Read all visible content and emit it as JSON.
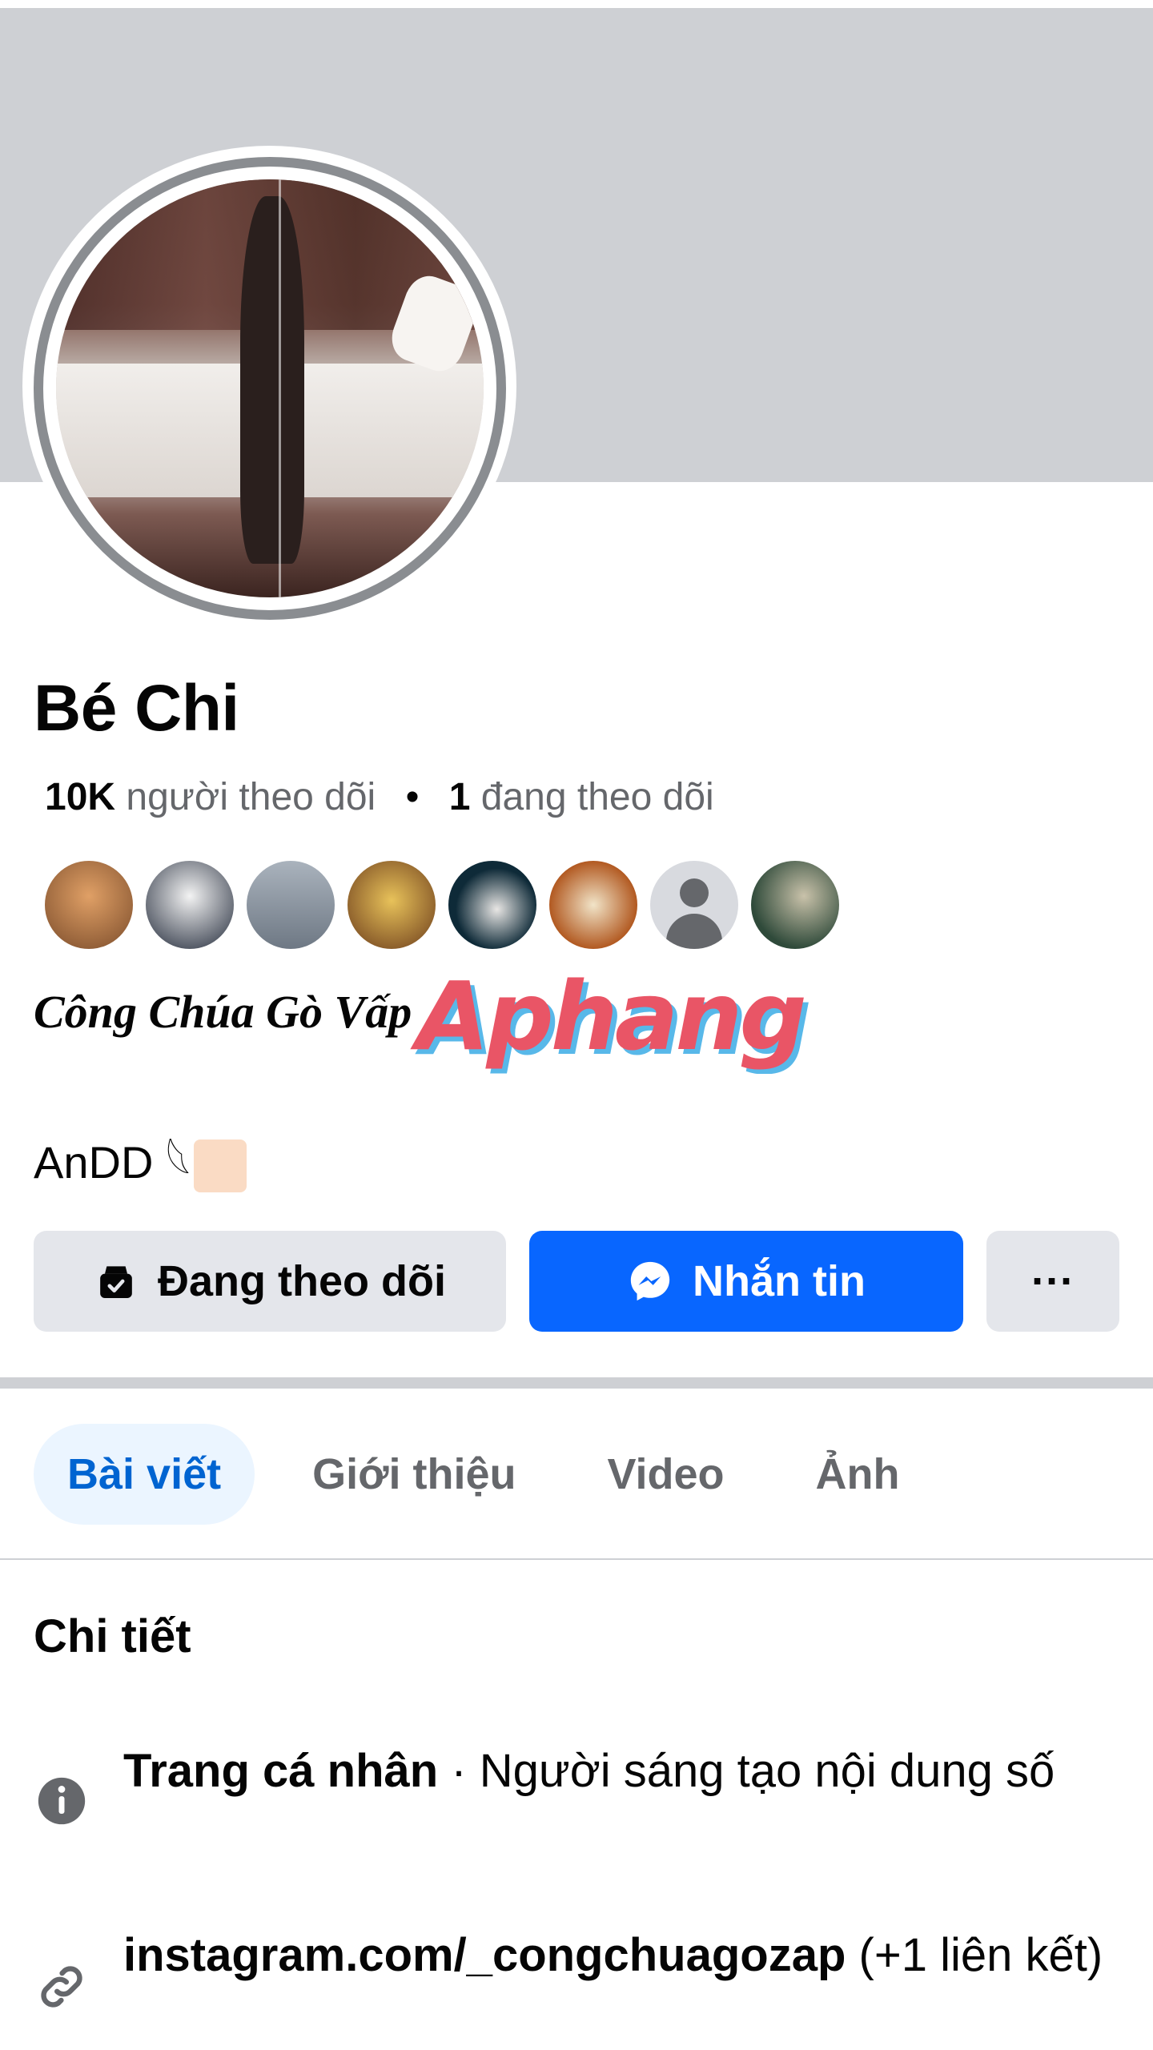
{
  "profile": {
    "name": "Bé Chi",
    "followers_count": "10K",
    "followers_label": "người theo dõi",
    "separator": "•",
    "following_count": "1",
    "following_label": "đang theo dõi",
    "bio": "Công Chúa Gò Vấp",
    "sub_bio": "AnDD 𓆩"
  },
  "watermark": {
    "text": "Aphang"
  },
  "actions": {
    "follow_label": "Đang theo dõi",
    "message_label": "Nhắn tin",
    "more_label": "···"
  },
  "tabs": [
    {
      "label": "Bài viết",
      "active": true
    },
    {
      "label": "Giới thiệu",
      "active": false
    },
    {
      "label": "Video",
      "active": false
    },
    {
      "label": "Ảnh",
      "active": false
    }
  ],
  "details": {
    "title": "Chi tiết",
    "items": [
      {
        "icon": "info-icon",
        "strong": "Trang cá nhân",
        "text": " · Người sáng tạo nội dung số"
      },
      {
        "icon": "link-icon",
        "strong": "instagram.com/_congchuagozap",
        "text": " (+1 liên kết)"
      }
    ]
  },
  "colors": {
    "primary": "#0866ff",
    "cover": "#ced0d4",
    "button_secondary": "#e4e6eb",
    "tab_active_bg": "#ebf5ff",
    "tab_active_text": "#0064d1",
    "muted_text": "#65676b"
  }
}
